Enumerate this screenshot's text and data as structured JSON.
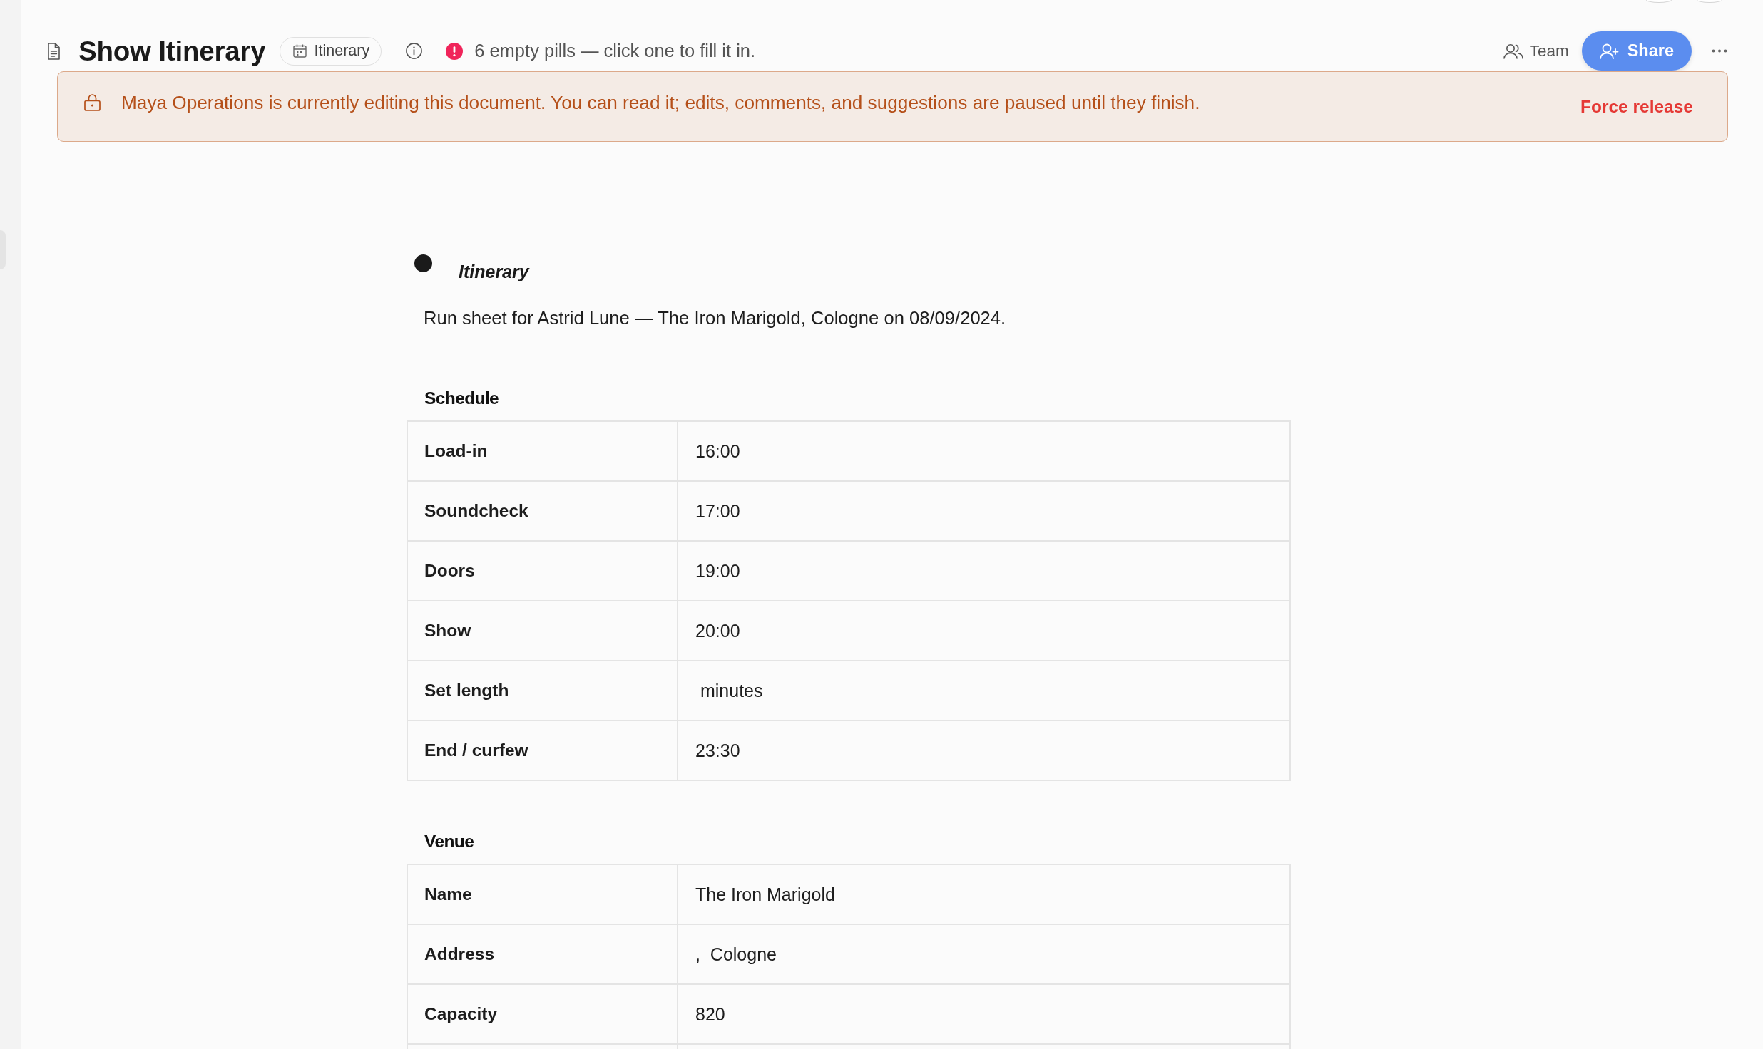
{
  "header": {
    "title": "Show Itinerary",
    "type_pill": "Itinerary",
    "notice": "6 empty pills — click one to fill it in.",
    "team_button": "Team",
    "share_button": "Share"
  },
  "lock_banner": {
    "message": "Maya Operations is currently editing this document. You can read it; edits, comments, and suggestions are paused until they finish.",
    "action": "Force release"
  },
  "document": {
    "heading": "Itinerary",
    "summary": "Run sheet for Astrid Lune — The Iron Marigold, Cologne on 08/09/2024.",
    "sections": [
      {
        "title": "Schedule",
        "rows": [
          {
            "label": "Load-in",
            "value": "16:00"
          },
          {
            "label": "Soundcheck",
            "value": "17:00"
          },
          {
            "label": "Doors",
            "value": "19:00"
          },
          {
            "label": "Show",
            "value": "20:00"
          },
          {
            "label": "Set length",
            "value": " minutes"
          },
          {
            "label": "End / curfew",
            "value": "23:30"
          }
        ]
      },
      {
        "title": "Venue",
        "rows": [
          {
            "label": "Name",
            "value": "The Iron Marigold"
          },
          {
            "label": "Address",
            "value": ",  Cologne"
          },
          {
            "label": "Capacity",
            "value": "820"
          }
        ]
      }
    ]
  }
}
